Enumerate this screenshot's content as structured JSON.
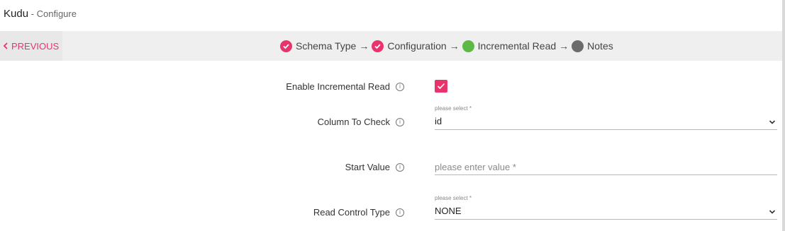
{
  "header": {
    "app_name": "Kudu",
    "subtitle": " - Configure"
  },
  "nav": {
    "previous_label": "PREVIOUS"
  },
  "wizard": {
    "arrow": "→",
    "steps": [
      {
        "label": "Schema Type",
        "status": "done"
      },
      {
        "label": "Configuration",
        "status": "done"
      },
      {
        "label": "Incremental Read",
        "status": "active"
      },
      {
        "label": "Notes",
        "status": "pending"
      }
    ]
  },
  "form": {
    "enable_incremental_read": {
      "label": "Enable Incremental Read",
      "checked": true
    },
    "column_to_check": {
      "label": "Column To Check",
      "hint": "please select *",
      "value": "id"
    },
    "start_value": {
      "label": "Start Value",
      "placeholder": "please enter value *",
      "value": ""
    },
    "read_control_type": {
      "label": "Read Control Type",
      "hint": "please select *",
      "value": "NONE"
    }
  },
  "colors": {
    "accent": "#e8336d",
    "active_step": "#5cb946",
    "pending_step": "#6b6b6b",
    "bar_background": "#efefef"
  }
}
